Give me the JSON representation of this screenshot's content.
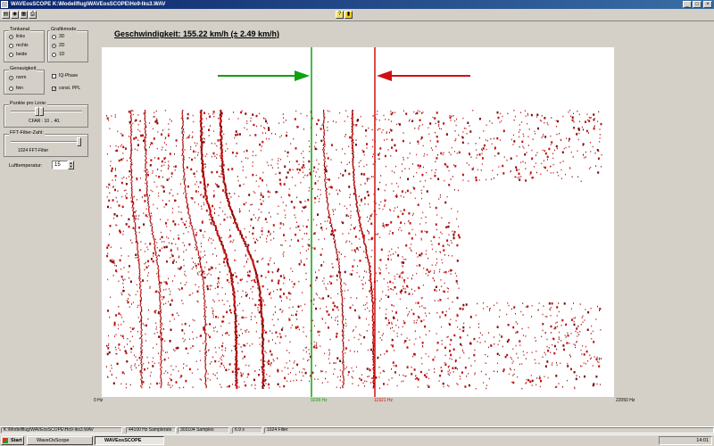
{
  "window": {
    "title": "WAVEosSCOPE  K:\\Modellflug\\WAVEosSCOPE\\Ho9-Iks3.WAV"
  },
  "toolbar": {
    "icons": [
      "open-icon",
      "record-icon",
      "spectrum-icon",
      "print-icon"
    ],
    "help": "?",
    "exit": "exit-icon"
  },
  "left": {
    "tonkanal": {
      "label": "Tonkanal",
      "options": [
        "links",
        "rechts",
        "beide"
      ],
      "selected": 0
    },
    "grafikmode": {
      "label": "Grafikmode",
      "options": [
        "3D",
        "2D",
        "1D"
      ],
      "selected": 1
    },
    "genauigkeit": {
      "label": "Genauigkeit",
      "options": [
        "norm",
        "fein"
      ],
      "selected": 0
    },
    "iq_phase": {
      "label": "IQ-Phase",
      "checked": false
    },
    "const_ppl": {
      "label": "const. PPL",
      "checked": true
    },
    "punkte": {
      "label": "Punkte pro Linie:",
      "cfar": "CFAR : 10 .. 40."
    },
    "fft": {
      "label": "FFT-Filter-Zahl:",
      "value": "1024 FFT-Filter"
    },
    "temp": {
      "label": "Lufttemperatur:",
      "value": "15"
    }
  },
  "heading": "Geschwindigkeit: 155.22 km/h (± 2.49 km/h)",
  "axis": {
    "start": "0 Hz",
    "m1": "9238 Hz",
    "m2": "11921 Hz",
    "end": "22050 Hz"
  },
  "status": [
    "K:\\Modellflug\\WAVEosSCOPE\\Ho9-Iks3.WAV",
    "44100 Hz Samplerate",
    "303104 Samples",
    "6.9 s",
    "1024 Filter"
  ],
  "taskbar": {
    "start": "Start",
    "task1": "WaveOsScope",
    "task2": "WAVEosSCOPE",
    "clock": "14:01"
  },
  "colors": {
    "green": "#10a010",
    "red": "#d01010",
    "dots": "#c01010"
  }
}
